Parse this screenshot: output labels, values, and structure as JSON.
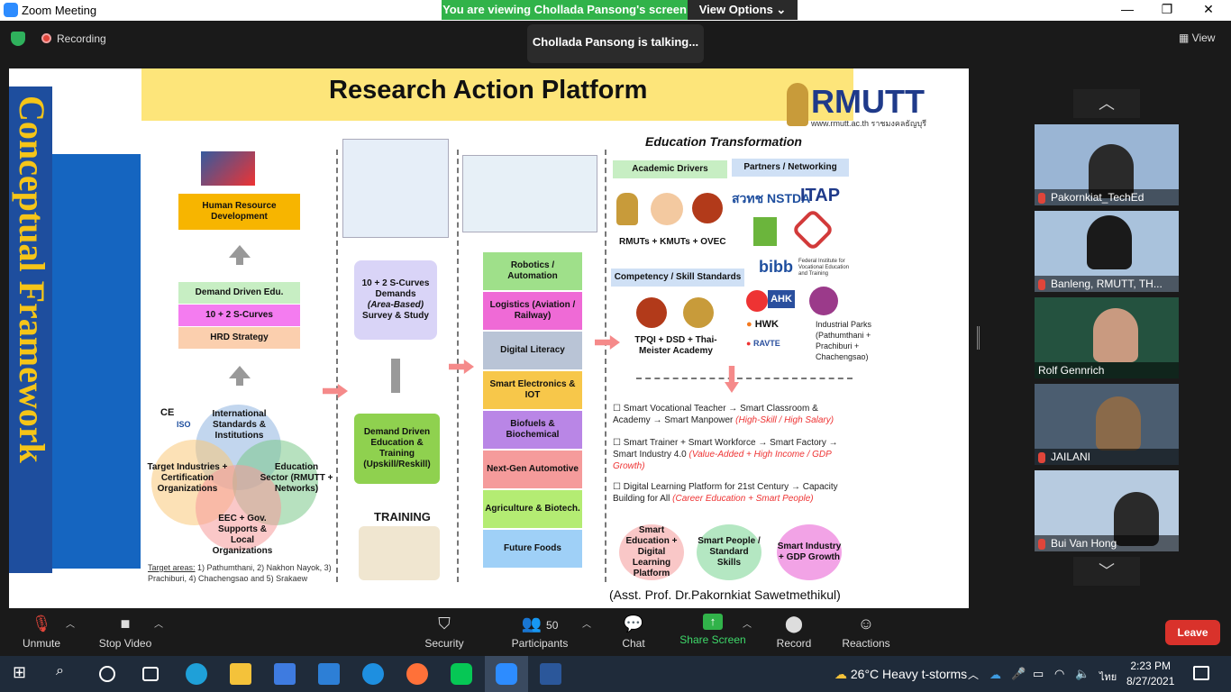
{
  "window": {
    "title": "Zoom Meeting",
    "minimize": "—",
    "maximize": "❐",
    "close": "✕"
  },
  "share_banner": "You are viewing Chollada Pansong's screen",
  "view_options": "View Options ⌄",
  "recording": "Recording",
  "talking": "Chollada Pansong is talking...",
  "view_button": "View",
  "slide": {
    "side_title": "Conceptual Framework",
    "title": "Research Action Platform",
    "logo": "RMUTT",
    "logo_url": "www.rmutt.ac.th  ราชมงคลธัญบุรี",
    "col1": {
      "hrd": "Human Resource Development",
      "demand": "Demand Driven Edu.",
      "scurves": "10 + 2 S-Curves",
      "strategy": "HRD Strategy",
      "venn": [
        "International Standards & Institutions",
        "Target Industries + Certification Organizations",
        "Education Sector (RMUTT + Networks)",
        "EEC + Gov. Supports & Local Organizations"
      ],
      "target_label": "Target areas:",
      "target_text": "1) Pathumthani, 2) Nakhon Nayok, 3) Prachiburi, 4) Chachengsao and 5) Srakaew"
    },
    "col2": {
      "box1_title": "10 + 2 S-Curves Demands",
      "box1_italic": "(Area-Based)",
      "box1_sub": "Survey & Study",
      "box2": "Demand Driven Education & Training (Upskill/Reskill)",
      "training": "TRAINING"
    },
    "col3": {
      "industries": [
        "Robotics / Automation",
        "Logistics (Aviation / Railway)",
        "Digital Literacy",
        "Smart Electronics & IOT",
        "Biofuels & Biochemical",
        "Next-Gen Automotive",
        "Agriculture & Biotech.",
        "Future Foods"
      ],
      "industry_colors": [
        "#9fe08a",
        "#ef6ad6",
        "#b9c4d6",
        "#f7c74a",
        "#b986e6",
        "#f59b9b",
        "#b4ec73",
        "#9fd0f7"
      ]
    },
    "col4": {
      "heading": "Education Transformation",
      "academic": "Academic Drivers",
      "partners": "Partners / Networking",
      "rmuts": "RMUTs + KMUTs + OVEC",
      "competency": "Competency / Skill Standards",
      "tpqi": "TPQI + DSD + Thai-Meister Academy",
      "itap": "ITAP",
      "nstda": "สวทช NSTDA",
      "bibb": "bibb",
      "bibb_sub": "Federal Institute for Vocational Education and Training",
      "ahk": "AHK",
      "hwk": "HWK",
      "ravte": "RAVTE",
      "parks": "Industrial Parks (Pathumthani + Prachiburi + Chachengsao)",
      "bullet1": "Smart Vocational Teacher → Smart Classroom & Academy → Smart Manpower",
      "bullet1_em": "(High-Skill / High Salary)",
      "bullet2": "Smart Trainer + Smart Workforce → Smart Factory → Smart Industry 4.0",
      "bullet2_em": "(Value-Added + High Income / GDP Growth)",
      "bullet3": "Digital Learning Platform for 21st Century → Capacity Building for All",
      "bullet3_em": "(Career Education + Smart People)",
      "smart1": "Smart Education + Digital Learning Platform",
      "smart2": "Smart People / Standard Skills",
      "smart3": "Smart Industry + GDP Growth",
      "author": "(Asst. Prof. Dr.Pakornkiat Sawetmethikul)"
    }
  },
  "participants_panel": [
    {
      "name": "Pakornkiat_TechEd",
      "muted": true
    },
    {
      "name": "Banleng, RMUTT, TH...",
      "muted": true
    },
    {
      "name": "Rolf Gennrich",
      "muted": false
    },
    {
      "name": "JAILANI",
      "muted": true
    },
    {
      "name": "Bui Van Hong",
      "muted": true
    }
  ],
  "toolbar": {
    "unmute": "Unmute",
    "stop_video": "Stop Video",
    "security": "Security",
    "participants": "Participants",
    "participant_count": "50",
    "chat": "Chat",
    "share_screen": "Share Screen",
    "record": "Record",
    "reactions": "Reactions",
    "leave": "Leave"
  },
  "taskbar": {
    "weather": "26°C  Heavy t-storms",
    "lang": "ไทย",
    "time": "2:23 PM",
    "date": "8/27/2021"
  }
}
